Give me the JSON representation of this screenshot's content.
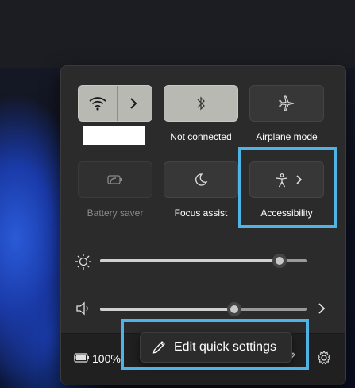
{
  "tiles": {
    "wifi": {
      "label": "",
      "active": true
    },
    "bluetooth": {
      "label": "Not connected",
      "active": true
    },
    "airplane": {
      "label": "Airplane mode",
      "active": false
    },
    "battery_saver": {
      "label": "Battery saver",
      "disabled": true
    },
    "focus_assist": {
      "label": "Focus assist",
      "active": false
    },
    "accessibility": {
      "label": "Accessibility",
      "active": false
    }
  },
  "brightness": {
    "level": 0.87
  },
  "volume": {
    "level": 0.65
  },
  "footer": {
    "battery_text": "100%"
  },
  "tooltip": {
    "text": "Edit quick settings"
  },
  "colors": {
    "highlight": "#4fb3e6",
    "tile_on": "#b9b9b4",
    "tile_off": "#373737",
    "panel": "#2b2b2b"
  },
  "icons": [
    "wifi-icon",
    "chevron-right-icon",
    "bluetooth-icon",
    "airplane-icon",
    "battery-saver-icon",
    "moon-icon",
    "accessibility-icon",
    "sun-icon",
    "speaker-icon",
    "battery-charging-icon",
    "pencil-icon",
    "gear-icon"
  ]
}
